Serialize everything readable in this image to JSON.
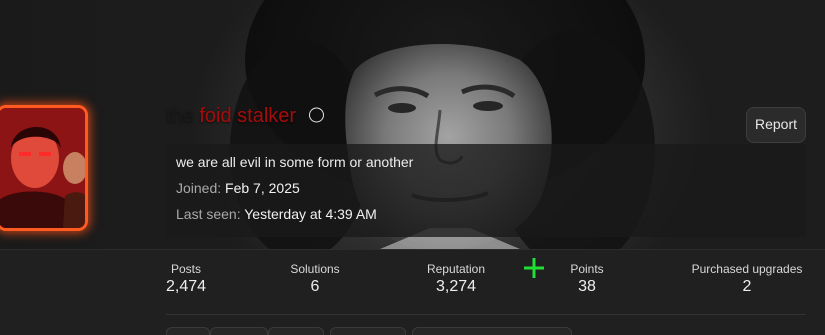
{
  "profile": {
    "username_part1": "the",
    "username_part2": "foid stalker",
    "about": "we are all evil in some form or another",
    "joined_label": "Joined:",
    "joined_value": "Feb 7, 2025",
    "last_seen_label": "Last seen:",
    "last_seen_value": "Yesterday at 4:39 AM",
    "report_label": "Report"
  },
  "stats": [
    {
      "label": "Posts",
      "value": "2,474"
    },
    {
      "label": "Solutions",
      "value": "6"
    },
    {
      "label": "Reputation",
      "value": "3,274"
    },
    {
      "label": "Points",
      "value": "38"
    },
    {
      "label": "Purchased upgrades",
      "value": "2"
    }
  ],
  "icons": {
    "history": "history-icon",
    "plus": "plus-icon"
  },
  "colors": {
    "username_dark": "#1a1a1a",
    "username_red": "#a50c0c",
    "avatar_glow": "#ff5a1f",
    "plus_green": "#22dd33"
  }
}
